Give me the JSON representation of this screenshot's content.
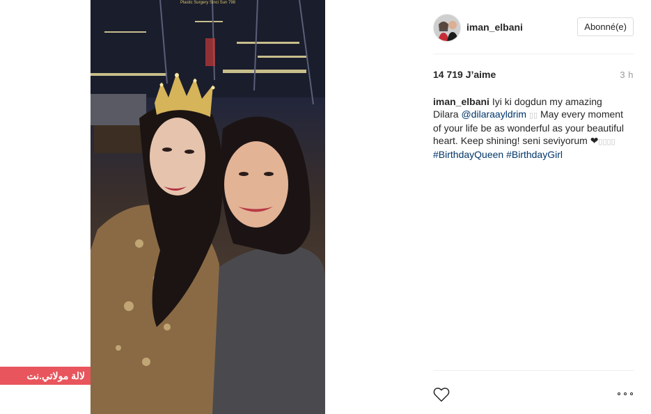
{
  "photo": {
    "top_caption": "Plastic Surgery Sinci Sun 798"
  },
  "watermark": {
    "text": "لالة مولاتي.نت",
    "color": "#e8555c"
  },
  "post": {
    "username": "iman_elbani",
    "follow_label": "Abonné(e)",
    "likes": "14 719 J’aime",
    "time": "3 h",
    "caption": {
      "user": "iman_elbani",
      "part1": "Iyi ki dogdun my amazing Dilara",
      "mention": "@dilaraayldrim",
      "boxes1": "▯▯",
      "part2": "May every moment of your life be as wonderful as your beautiful heart. Keep shining! seni seviyorum",
      "heart": "❤",
      "boxes2": "▯▯▯▯",
      "hashtag1": "#BirthdayQueen",
      "hashtag2": "#BirthdayGirl"
    },
    "link_color": "#003569",
    "like_icon": "heart-outline-icon",
    "more_icon": "ellipsis-icon"
  }
}
